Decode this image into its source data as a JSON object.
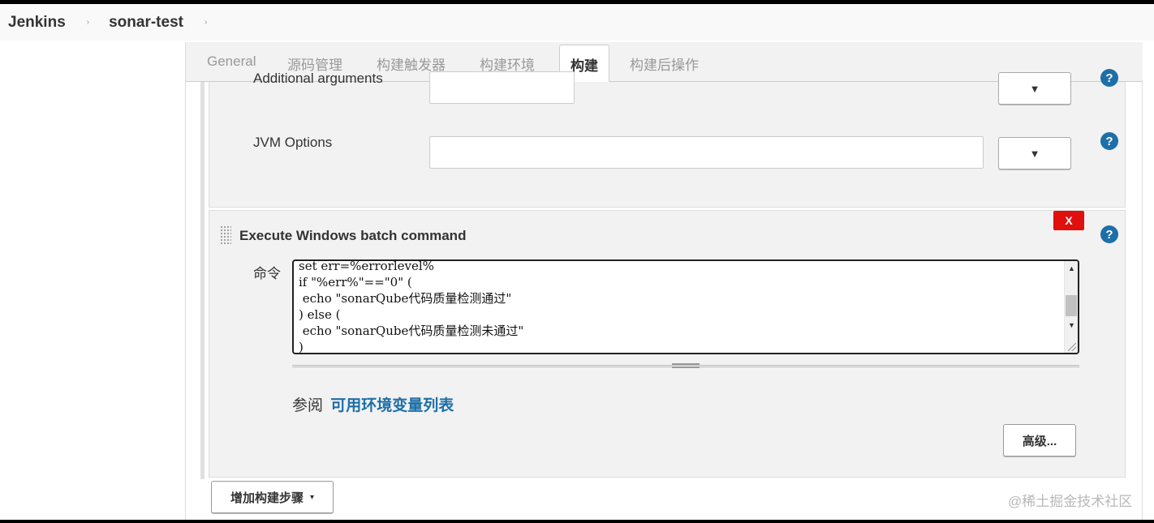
{
  "breadcrumb": {
    "items": [
      "Jenkins",
      "sonar-test"
    ],
    "separator": "›"
  },
  "tabs": [
    {
      "label": "General"
    },
    {
      "label": "源码管理"
    },
    {
      "label": "构建触发器"
    },
    {
      "label": "构建环境"
    },
    {
      "label": "构建"
    },
    {
      "label": "构建后操作"
    }
  ],
  "active_tab": "构建",
  "sonar_section": {
    "additional_arguments_label": "Additional arguments",
    "additional_arguments_value": "",
    "jvm_options_label": "JVM Options",
    "jvm_options_value": "",
    "dropdown_glyph": "▼",
    "help_glyph": "?"
  },
  "batch_section": {
    "title": "Execute Windows batch command",
    "delete_label": "X",
    "command_label": "命令",
    "command_text": "set err=%errorlevel%\nif \"%err%\"==\"0\" (\n echo \"sonarQube代码质量检测通过\"\n) else (\n echo \"sonarQube代码质量检测未通过\"\n)",
    "see_also_prefix": "参阅",
    "see_also_link": "可用环境变量列表",
    "advanced_button": "高级..."
  },
  "add_build_step": {
    "label": "增加构建步骤",
    "caret": "▾"
  },
  "watermark": "@稀土掘金技术社区",
  "colors": {
    "accent": "#1d6fa8",
    "delete": "#e0100f",
    "panel": "#f2f2f2"
  },
  "icons": [
    "help-icon",
    "dropdown-arrow-icon",
    "delete-icon",
    "drag-grip-icon",
    "caret-down-icon"
  ]
}
